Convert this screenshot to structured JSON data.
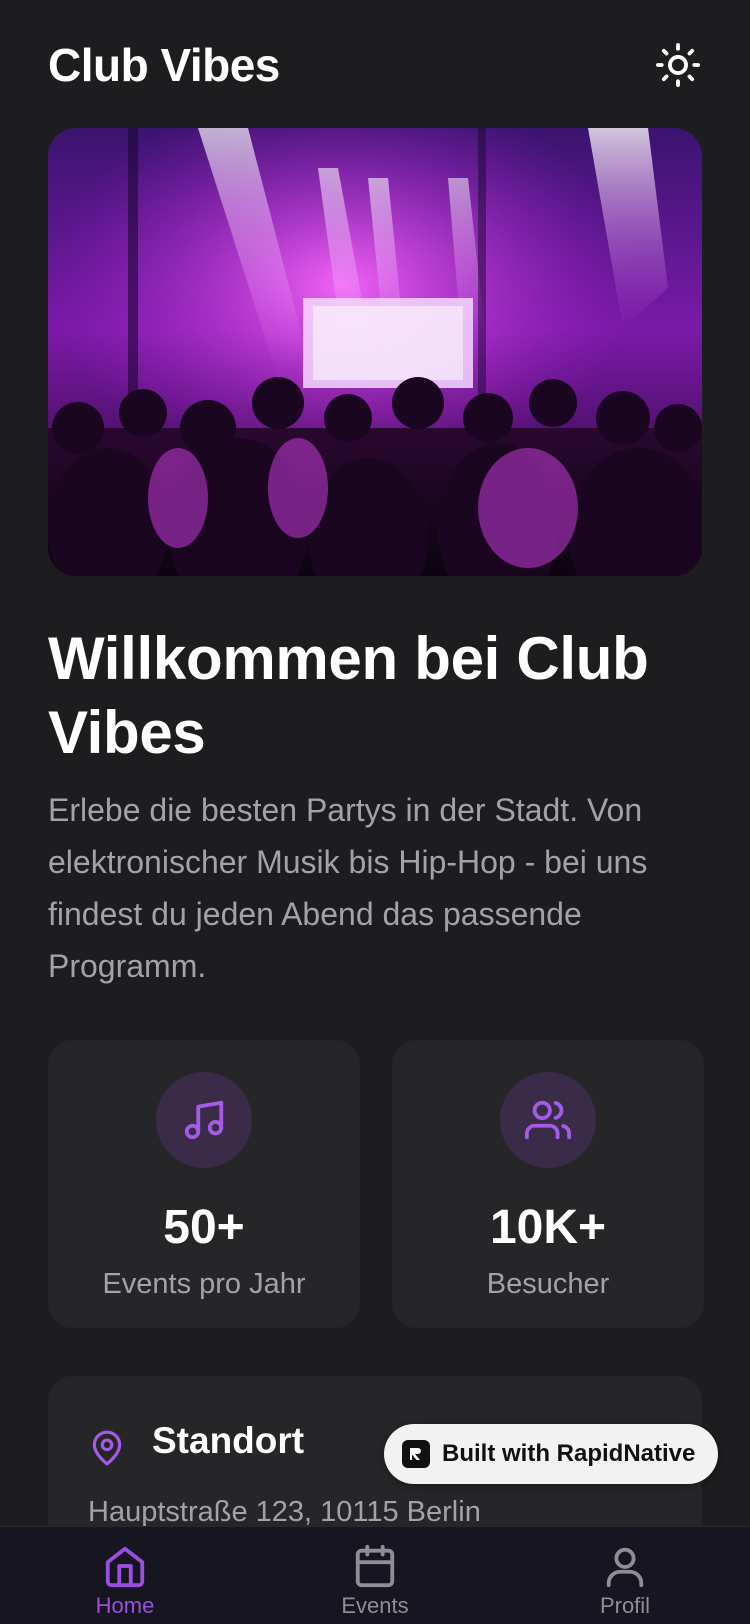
{
  "header": {
    "title": "Club Vibes",
    "theme_icon": "sun-icon"
  },
  "hero": {
    "image": "concert-crowd-stage-lights"
  },
  "welcome": {
    "title": "Willkommen bei Club Vibes",
    "text": "Erlebe die besten Partys in der Stadt. Von elektronischer Musik bis Hip-Hop - bei uns findest du jeden Abend das passende Programm."
  },
  "stats": [
    {
      "icon": "music-note-icon",
      "value": "50+",
      "label": "Events pro Jahr"
    },
    {
      "icon": "users-icon",
      "value": "10K+",
      "label": "Besucher"
    }
  ],
  "location": {
    "icon": "map-pin-icon",
    "title": "Standort",
    "address": "Hauptstraße 123, 10115 Berlin"
  },
  "badge": {
    "text": "Built with RapidNative"
  },
  "tabs": [
    {
      "icon": "home-icon",
      "label": "Home",
      "active": true
    },
    {
      "icon": "calendar-icon",
      "label": "Events",
      "active": false
    },
    {
      "icon": "profile-icon",
      "label": "Profil",
      "active": false
    }
  ],
  "colors": {
    "accent": "#9b4fe0",
    "background": "#1d1d1f",
    "card": "#262628",
    "muted_text": "#a2a2a8"
  }
}
